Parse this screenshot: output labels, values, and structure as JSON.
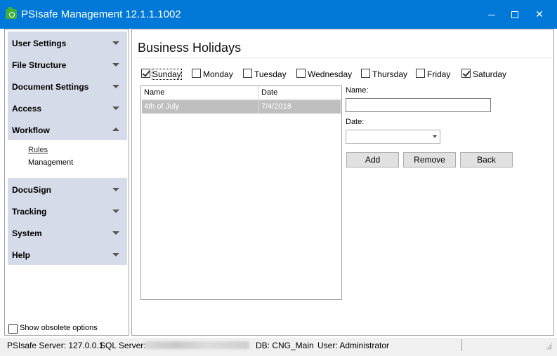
{
  "window": {
    "title": "PSIsafe Management 12.1.1.1002"
  },
  "sidebar": {
    "groups_top": [
      {
        "label": "User Settings"
      },
      {
        "label": "File Structure"
      },
      {
        "label": "Document Settings"
      },
      {
        "label": "Access"
      },
      {
        "label": "Workflow",
        "expanded": true
      }
    ],
    "workflow_children": [
      {
        "label": "Rules"
      },
      {
        "label": "Management"
      }
    ],
    "groups_bottom": [
      {
        "label": "DocuSign"
      },
      {
        "label": "Tracking"
      },
      {
        "label": "System"
      },
      {
        "label": "Help"
      }
    ],
    "obsolete_label": "Show obsolete options"
  },
  "main": {
    "title": "Business Holidays",
    "days": [
      {
        "label": "Sunday",
        "checked": true
      },
      {
        "label": "Monday",
        "checked": false
      },
      {
        "label": "Tuesday",
        "checked": false
      },
      {
        "label": "Wednesday",
        "checked": false
      },
      {
        "label": "Thursday",
        "checked": false
      },
      {
        "label": "Friday",
        "checked": false
      },
      {
        "label": "Saturday",
        "checked": true
      }
    ],
    "grid": {
      "columns": [
        "Name",
        "Date"
      ],
      "rows": [
        {
          "name": "4th of July",
          "date": "7/4/2018"
        }
      ]
    },
    "name_label": "Name:",
    "name_value": "",
    "date_label": "Date:",
    "date_value": "",
    "buttons": {
      "add": "Add",
      "remove": "Remove",
      "back": "Back"
    }
  },
  "status": {
    "server": "PSIsafe Server: 127.0.0.1",
    "sql_label": "SQL Server:",
    "db": "DB: CNG_Main",
    "user": "User: Administrator"
  },
  "colors": {
    "titlebar": "#0078d7",
    "nav_group": "#d6dbe9",
    "selected_row": "#bfbfbf"
  }
}
